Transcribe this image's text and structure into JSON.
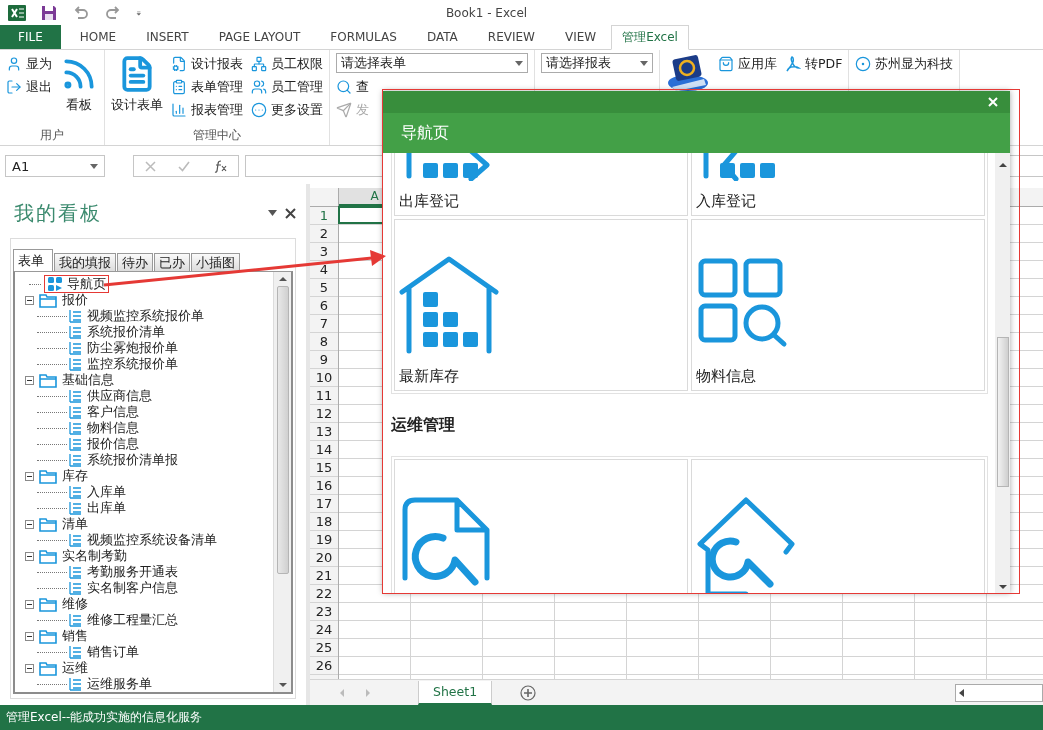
{
  "window": {
    "title": "Book1 - Excel"
  },
  "ribbon_tabs": [
    {
      "label": "FILE",
      "kind": "file",
      "selected": false
    },
    {
      "label": "HOME",
      "kind": "tab",
      "selected": false
    },
    {
      "label": "INSERT",
      "kind": "tab",
      "selected": false
    },
    {
      "label": "PAGE LAYOUT",
      "kind": "tab",
      "selected": false
    },
    {
      "label": "FORMULAS",
      "kind": "tab",
      "selected": false
    },
    {
      "label": "DATA",
      "kind": "tab",
      "selected": false
    },
    {
      "label": "REVIEW",
      "kind": "tab",
      "selected": false
    },
    {
      "label": "VIEW",
      "kind": "tab",
      "selected": false
    },
    {
      "label": "管理Excel",
      "kind": "tab",
      "selected": true
    }
  ],
  "ribbon_groups": [
    {
      "label": "用户",
      "columns": [
        [
          {
            "label": "显为",
            "kind": "small",
            "disabled": false
          },
          {
            "label": "退出",
            "kind": "small",
            "disabled": false
          }
        ],
        [
          {
            "label": "看板",
            "kind": "large",
            "disabled": false
          }
        ]
      ]
    },
    {
      "label": "管理中心",
      "columns": [
        [
          {
            "label": "设计表单",
            "kind": "large",
            "disabled": false
          }
        ],
        [
          {
            "label": "设计报表",
            "kind": "small",
            "disabled": false
          },
          {
            "label": "表单管理",
            "kind": "small",
            "disabled": false
          },
          {
            "label": "报表管理",
            "kind": "small",
            "disabled": false
          }
        ],
        [
          {
            "label": "员工权限",
            "kind": "small",
            "disabled": false
          },
          {
            "label": "员工管理",
            "kind": "small",
            "disabled": false
          },
          {
            "label": "更多设置",
            "kind": "small",
            "disabled": false
          }
        ]
      ]
    },
    {
      "combo": "请选择表单",
      "rows": [
        [
          {
            "label": "查",
            "kind": "small",
            "disabled": false
          }
        ],
        [
          {
            "label": "发",
            "kind": "small",
            "disabled": true
          }
        ]
      ]
    },
    {
      "combo": "请选择报表"
    },
    {
      "columns": [
        [
          {
            "kind": "icon"
          }
        ],
        [
          {
            "label": "应用库",
            "kind": "small",
            "disabled": false
          }
        ],
        [
          {
            "label": "转PDF",
            "kind": "small",
            "disabled": false
          }
        ]
      ]
    },
    {
      "columns": [
        [
          {
            "label": "苏州显为科技",
            "kind": "small",
            "disabled": false
          }
        ]
      ]
    }
  ],
  "formula_bar": {
    "name_box": "A1"
  },
  "panel": {
    "title": "我的看板",
    "tabs": [
      {
        "label": "表单",
        "selected": true
      },
      {
        "label": "我的填报",
        "selected": false
      },
      {
        "label": "待办",
        "selected": false
      },
      {
        "label": "已办",
        "selected": false
      },
      {
        "label": "小插图",
        "selected": false
      }
    ],
    "tree": [
      {
        "label": "导航页",
        "kind": "nav",
        "marked": true
      },
      {
        "label": "报价",
        "kind": "folder",
        "expanded": true,
        "children": [
          {
            "label": "视频监控系统报价单",
            "kind": "form"
          },
          {
            "label": "系统报价清单",
            "kind": "form"
          },
          {
            "label": "防尘雾炮报价单",
            "kind": "form"
          },
          {
            "label": "监控系统报价单",
            "kind": "form"
          }
        ]
      },
      {
        "label": "基础信息",
        "kind": "folder",
        "expanded": true,
        "children": [
          {
            "label": "供应商信息",
            "kind": "form"
          },
          {
            "label": "客户信息",
            "kind": "form"
          },
          {
            "label": "物料信息",
            "kind": "form"
          },
          {
            "label": "报价信息",
            "kind": "form"
          },
          {
            "label": "系统报价清单报",
            "kind": "form"
          }
        ]
      },
      {
        "label": "库存",
        "kind": "folder",
        "expanded": true,
        "children": [
          {
            "label": "入库单",
            "kind": "form"
          },
          {
            "label": "出库单",
            "kind": "form"
          }
        ]
      },
      {
        "label": "清单",
        "kind": "folder",
        "expanded": true,
        "children": [
          {
            "label": "视频监控系统设备清单",
            "kind": "form"
          }
        ]
      },
      {
        "label": "实名制考勤",
        "kind": "folder",
        "expanded": true,
        "children": [
          {
            "label": "考勤服务开通表",
            "kind": "form"
          },
          {
            "label": "实名制客户信息",
            "kind": "form"
          }
        ]
      },
      {
        "label": "维修",
        "kind": "folder",
        "expanded": true,
        "children": [
          {
            "label": "维修工程量汇总",
            "kind": "form"
          }
        ]
      },
      {
        "label": "销售",
        "kind": "folder",
        "expanded": true,
        "children": [
          {
            "label": "销售订单",
            "kind": "form"
          }
        ]
      },
      {
        "label": "运维",
        "kind": "folder",
        "expanded": true,
        "children": [
          {
            "label": "运维服务单",
            "kind": "form"
          }
        ]
      }
    ]
  },
  "sheet": {
    "columns": [
      "A"
    ],
    "rows": [
      "1",
      "2",
      "3",
      "4",
      "5",
      "6",
      "7",
      "8",
      "9",
      "10",
      "11",
      "12",
      "13",
      "14",
      "15",
      "16",
      "17",
      "18",
      "19",
      "20",
      "21",
      "22",
      "23",
      "24",
      "25",
      "26"
    ],
    "tabs": [
      {
        "label": "Sheet1",
        "selected": true
      }
    ]
  },
  "dialog": {
    "title": "导航页",
    "sections": [
      {
        "tiles": [
          {
            "label": "出库登记",
            "kind": "outbound"
          },
          {
            "label": "入库登记",
            "kind": "inbound"
          },
          {
            "label": "最新库存",
            "kind": "stock"
          },
          {
            "label": "物料信息",
            "kind": "material"
          }
        ]
      },
      {
        "heading": "运维管理",
        "tiles": [
          {
            "kind": "repair-doc"
          },
          {
            "kind": "repair-house"
          }
        ]
      }
    ]
  },
  "status_bar": {
    "text": "管理Excel--能成功实施的信息化服务"
  }
}
